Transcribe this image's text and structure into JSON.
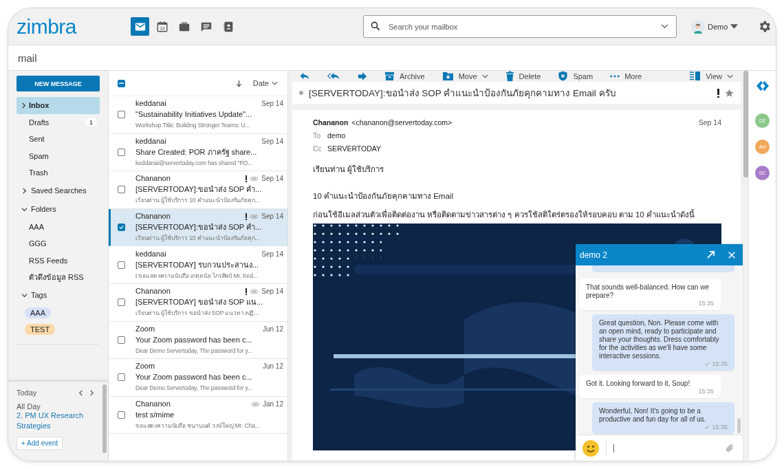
{
  "header": {
    "logo": "zimbra",
    "apps": [
      {
        "kind": "mail",
        "selected": true
      },
      {
        "kind": "calendar",
        "selected": false,
        "day": "19"
      },
      {
        "kind": "briefcase",
        "selected": false
      },
      {
        "kind": "chat",
        "selected": false
      },
      {
        "kind": "contacts",
        "selected": false
      }
    ],
    "search": {
      "placeholder": "Search your mailbox"
    },
    "user": "Demo"
  },
  "page_title": "mail",
  "sidebar": {
    "new_message": "NEW MESSAGE",
    "folders": [
      {
        "label": "Inbox",
        "selected": true,
        "expanded": false
      },
      {
        "label": "Drafts",
        "selected": false,
        "count": "1"
      },
      {
        "label": "Sent",
        "selected": false
      },
      {
        "label": "Spam",
        "selected": false
      },
      {
        "label": "Trash",
        "selected": false
      }
    ],
    "saved_searches": {
      "label": "Saved Searches",
      "expanded": false
    },
    "folder_tree": {
      "label": "Folders",
      "expanded": true,
      "children": [
        {
          "label": "AAA"
        },
        {
          "label": "GGG"
        },
        {
          "label": "RSS Feeds"
        },
        {
          "label": "ตัวดึงข้อมูล RSS"
        }
      ]
    },
    "tags": {
      "label": "Tags",
      "expanded": true,
      "children": [
        {
          "label": "AAA",
          "color": "#d6e1f8"
        },
        {
          "label": "TEST",
          "color": "#fcd9a8"
        }
      ]
    },
    "agenda": {
      "title": "Today",
      "all_day": "All Day",
      "event": "2. PM UX Research Strategies",
      "add_event": "+ Add event"
    }
  },
  "message_list": {
    "select_all": {
      "checked": true,
      "partial": true
    },
    "sort": "Date",
    "messages": [
      {
        "from": "keddanai",
        "subject": "\"Sustainability Initiatives Update\"...",
        "preview": "Workshop Title: Building Stronger Teams: U...",
        "date": "Sep 14",
        "important": false,
        "tagged": false,
        "selected": false,
        "checked": false
      },
      {
        "from": "keddanai",
        "subject": "Share Created: POR ภาครัฐ share...",
        "preview": "keddanai@servertoday.com has shared \"PO...",
        "date": "Sep 14",
        "important": false,
        "tagged": false,
        "selected": false,
        "checked": false
      },
      {
        "from": "Chananon",
        "subject": "[SERVERTODAY]:ขอนำส่ง SOP คำ...",
        "preview": "เรียนท่าน ผู้ใช้บริการ 10 คำแนะนำป้องกันภัยคุก...",
        "date": "Sep 14",
        "important": true,
        "tagged": true,
        "selected": false,
        "checked": false
      },
      {
        "from": "Chananon",
        "subject": "[SERVERTODAY]:ขอนำส่ง SOP คำ...",
        "preview": "เรียนท่าน ผู้ใช้บริการ 10 คำแนะนำป้องกันภัยคุก...",
        "date": "Sep 14",
        "important": true,
        "tagged": true,
        "selected": true,
        "checked": true
      },
      {
        "from": "keddanai",
        "subject": "[SERVERTODAY] รบกวนประสานง...",
        "preview": "t ขอแสดงความนับถือ เกตุดนัย ไกรศิลป์ Mr. Ked...",
        "date": "Sep 14",
        "important": false,
        "tagged": false,
        "selected": false,
        "checked": false
      },
      {
        "from": "Chananon",
        "subject": "[SERVERTODAY] ขอนำส่ง SOP แน...",
        "preview": "เรียนท่าน ผู้ใช้บริการ ขอนำส่ง SOP แนวทางปฏิ...",
        "date": "Sep 14",
        "important": true,
        "tagged": true,
        "selected": false,
        "checked": false
      },
      {
        "from": "Zoom",
        "subject": "Your Zoom password has been c...",
        "preview": "Dear Demo Servertoday, The password for y...",
        "date": "Jun 12",
        "important": false,
        "tagged": false,
        "selected": false,
        "checked": false
      },
      {
        "from": "Zoom",
        "subject": "Your Zoom password has been c...",
        "preview": "Dear Demo Servertoday, The password for y...",
        "date": "Jun 12",
        "important": false,
        "tagged": false,
        "selected": false,
        "checked": false
      },
      {
        "from": "Chananon",
        "subject": "test s/mime",
        "preview": "ขอแสดงความนับถือ ชนานนท์ วงษ์ใหญ่ Mr. Cha...",
        "date": "Jan 12",
        "important": false,
        "tagged": true,
        "selected": false,
        "checked": false
      }
    ]
  },
  "reader": {
    "actions": [
      {
        "kind": "reply"
      },
      {
        "kind": "reply-all"
      },
      {
        "kind": "forward"
      },
      {
        "kind": "archive",
        "label": "Archive"
      },
      {
        "kind": "move",
        "label": "Move",
        "dropdown": true
      },
      {
        "kind": "delete",
        "label": "Delete"
      },
      {
        "kind": "spam",
        "label": "Spam"
      },
      {
        "kind": "more",
        "label": "More"
      }
    ],
    "view": {
      "label": "View",
      "dropdown": true
    },
    "subject": "[SERVERTODAY]:ขอนำส่ง SOP คำแนะนำป้องกันภัยคุกคามทาง Email ครับ",
    "important": true,
    "starred": false,
    "from_name": "Chananon",
    "from_email": "<chananon@servertoday.com>",
    "date": "Sep 14",
    "recipients": [
      {
        "label": "To",
        "value": "demo"
      },
      {
        "label": "Cc",
        "value": "SERVERTODAY"
      }
    ],
    "body": [
      "เรียนท่าน ผู้ใช้บริการ",
      "10 คำแนะนำป้องกันภัยคุกคามทาง Email",
      "ก่อนใช้อีเมลส่วนตัวเพื่อติดต่องาน หรือติดตามข่าวสารต่าง ๆ ควรใช้สติใตร่ตรองให้รอบคอบ ตาม 10 คำแนะนำดังนี้"
    ],
    "image": {
      "kind": "picture"
    }
  },
  "chat": {
    "title": "demo 2",
    "messages": [
      {
        "mine": false,
        "text": "That sounds well-balanced. How can we prepare?",
        "time": "15:35"
      },
      {
        "mine": true,
        "text": "Great question, Non. Please come with an open mind, ready to participate and share your thoughts. Dress comfortably for the activities as we'll have some interactive sessions.",
        "time": "15:35"
      },
      {
        "mine": false,
        "text": "Got it. Looking forward to it, Soup!",
        "time": "15:35"
      },
      {
        "mine": true,
        "text": "Wonderful, Non! It's going to be a productive and fun day for all of us.",
        "time": "15:35"
      }
    ]
  },
  "rail": {
    "contacts": [
      {
        "initials": "D2",
        "color": "#8bc78a"
      },
      {
        "initials": "AH",
        "color": "#f2a85a"
      },
      {
        "initials": "SC",
        "color": "#a77bc9"
      }
    ]
  }
}
